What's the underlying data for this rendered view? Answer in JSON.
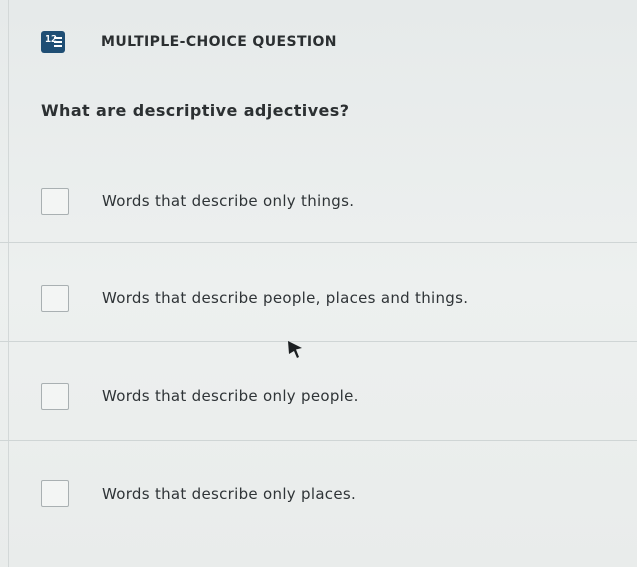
{
  "header": {
    "type_icon": "multiple-choice-list-icon",
    "type_icon_number": "12",
    "label": "MULTIPLE-CHOICE QUESTION"
  },
  "question": {
    "text": "What are descriptive adjectives?"
  },
  "options": [
    {
      "label": "Words that describe only things.",
      "checked": false
    },
    {
      "label": "Words that describe people, places and things.",
      "checked": false
    },
    {
      "label": "Words that describe only people.",
      "checked": false
    },
    {
      "label": "Words that describe only places.",
      "checked": false
    }
  ],
  "colors": {
    "icon_background": "#1f4e74",
    "text": "#2f3437",
    "background": "#e9ecec"
  }
}
